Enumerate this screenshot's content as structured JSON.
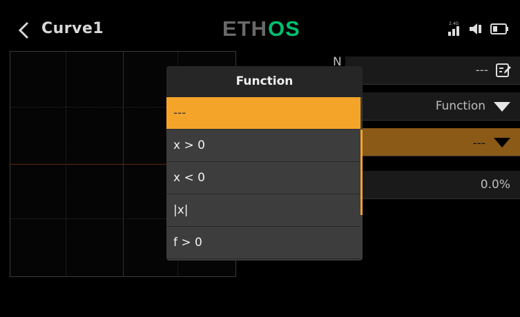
{
  "header": {
    "title": "Curve1",
    "logo_text": "ETHOS",
    "radio_band": "2.4G"
  },
  "fields": {
    "name_label_fragment": "N",
    "name_value": "---",
    "type_value": "Function",
    "function_value": "---",
    "percent_value": "0.0%"
  },
  "popup": {
    "title": "Function",
    "items": [
      "---",
      "x > 0",
      "x < 0",
      "|x|",
      "f > 0"
    ],
    "selected_index": 0
  },
  "colors": {
    "accent": "#f5a42a",
    "logo_green": "#00c070"
  }
}
